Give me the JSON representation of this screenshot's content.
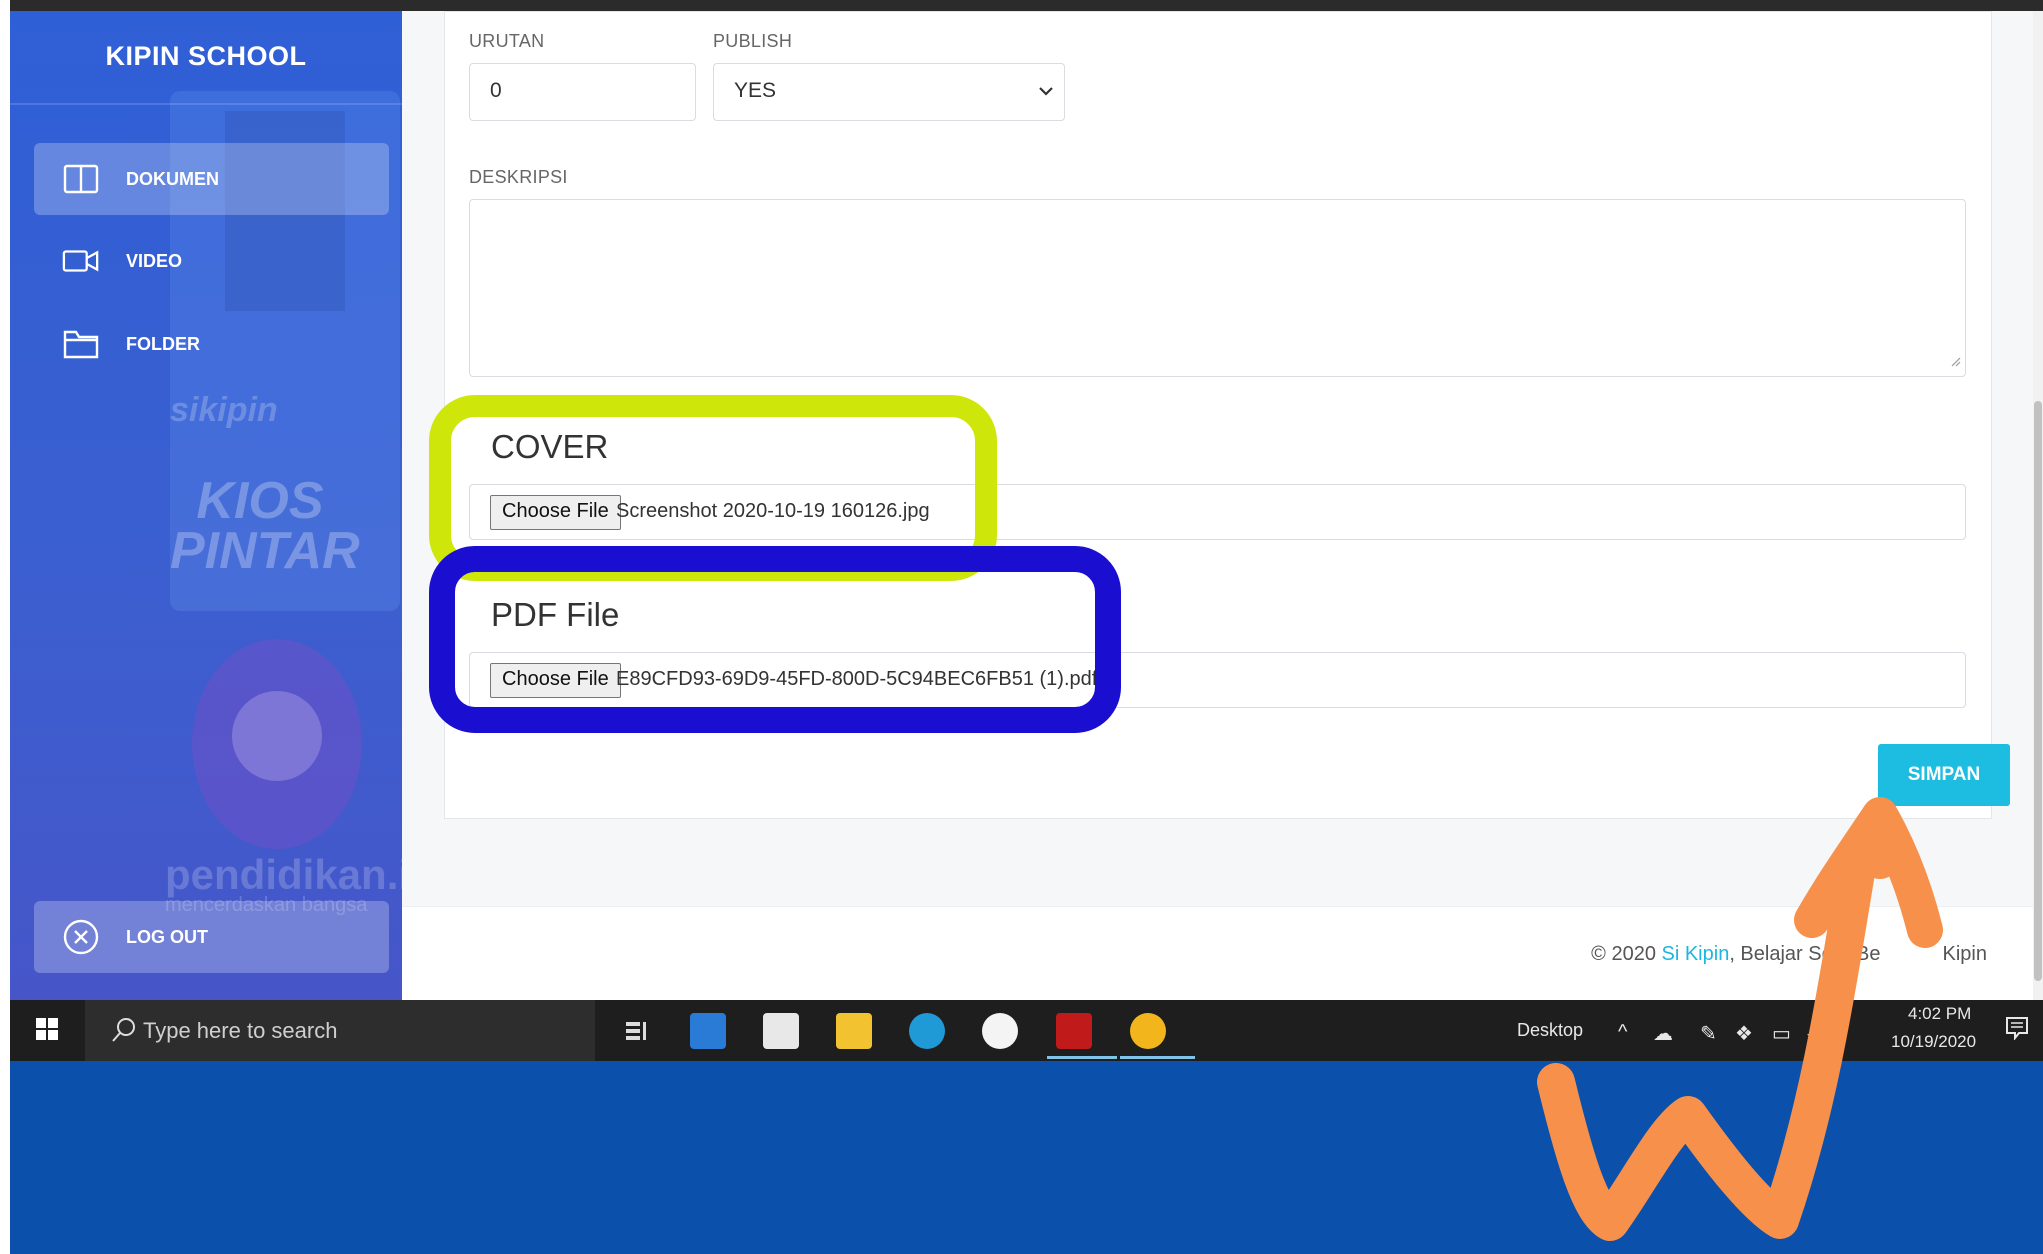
{
  "sidebar": {
    "title": "KIPIN SCHOOL",
    "items": [
      {
        "label": "DOKUMEN",
        "icon": "book-icon",
        "active": true
      },
      {
        "label": "VIDEO",
        "icon": "video-icon",
        "active": false
      },
      {
        "label": "FOLDER",
        "icon": "folder-icon",
        "active": false
      }
    ],
    "logout_label": "LOG OUT",
    "background_text": {
      "logo": "sikipin",
      "kios_line1": "KIOS",
      "kios_line2": "PINTAR",
      "brand": "pendidikan.id",
      "tagline": "mencerdaskan bangsa"
    }
  },
  "form": {
    "urutan_label": "URUTAN",
    "urutan_value": "0",
    "publish_label": "PUBLISH",
    "publish_value": "YES",
    "deskripsi_label": "DESKRIPSI",
    "deskripsi_value": "",
    "cover_label": "COVER",
    "cover_button": "Choose File",
    "cover_filename": "Screenshot 2020-10-19 160126.jpg",
    "pdf_label": "PDF File",
    "pdf_button": "Choose File",
    "pdf_filename": "E89CFD93-69D9-45FD-800D-5C94BEC6FB51 (1).pdf",
    "save_button": "SIMPAN"
  },
  "footer": {
    "prefix": "© 2020 ",
    "link": "Si Kipin",
    "suffix": ", Belajar Seru Be",
    "end": "Kipin"
  },
  "taskbar": {
    "search_placeholder": "Type here to search",
    "desktop_label": "Desktop",
    "time": "4:02 PM",
    "date": "10/19/2020"
  },
  "colors": {
    "sidebar": "#3b5fd0",
    "accent": "#1cbde0",
    "highlight_green": "#cfe60a",
    "highlight_blue": "#1a0fd0",
    "annotation_arrow": "#f7904a"
  }
}
